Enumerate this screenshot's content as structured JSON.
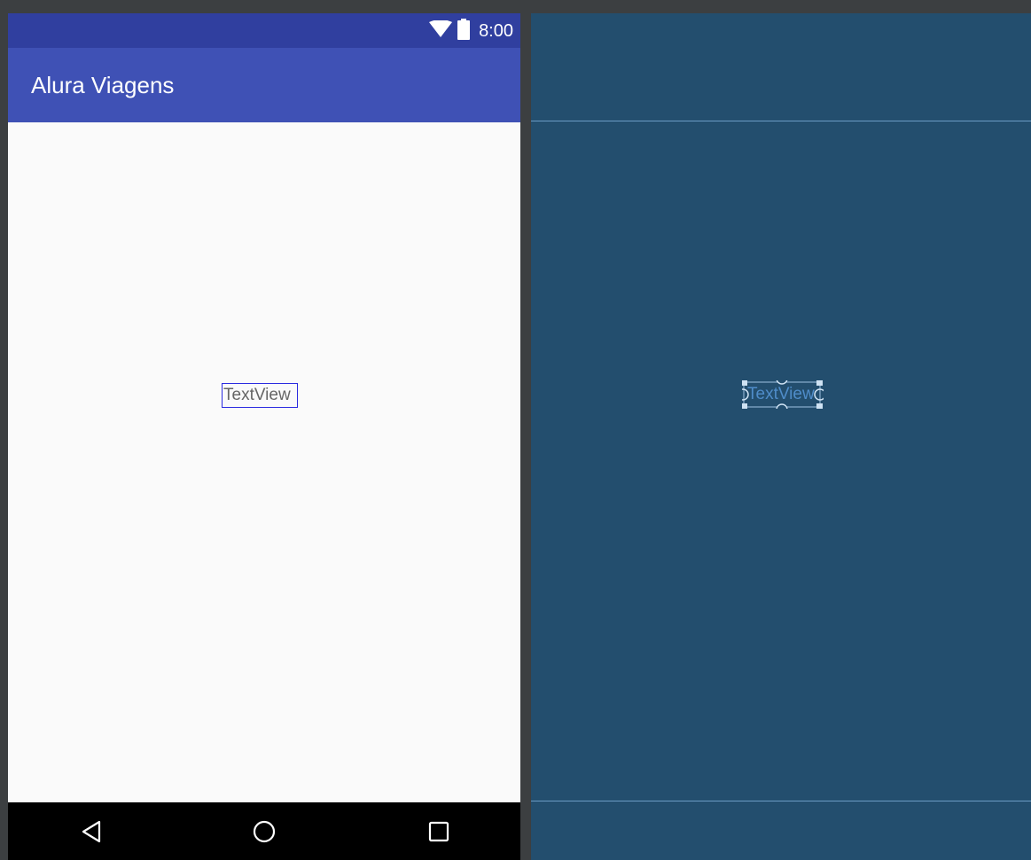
{
  "status_bar": {
    "time": "8:00",
    "icons": [
      "wifi-icon",
      "battery-icon"
    ]
  },
  "app_bar": {
    "title": "Alura Viagens"
  },
  "content": {
    "textview_text": "TextView"
  },
  "blueprint": {
    "textview_text": "TextView"
  },
  "nav_bar": {
    "icons": [
      "back-icon",
      "home-icon",
      "recents-icon"
    ]
  },
  "colors": {
    "status_bar": "#303f9f",
    "app_bar": "#3f51b5",
    "content_bg": "#fafafa",
    "nav_bar": "#000000",
    "blueprint_bg": "#234e6e",
    "blueprint_line": "#6b9bc4",
    "selection_border": "#2a2ae0"
  }
}
